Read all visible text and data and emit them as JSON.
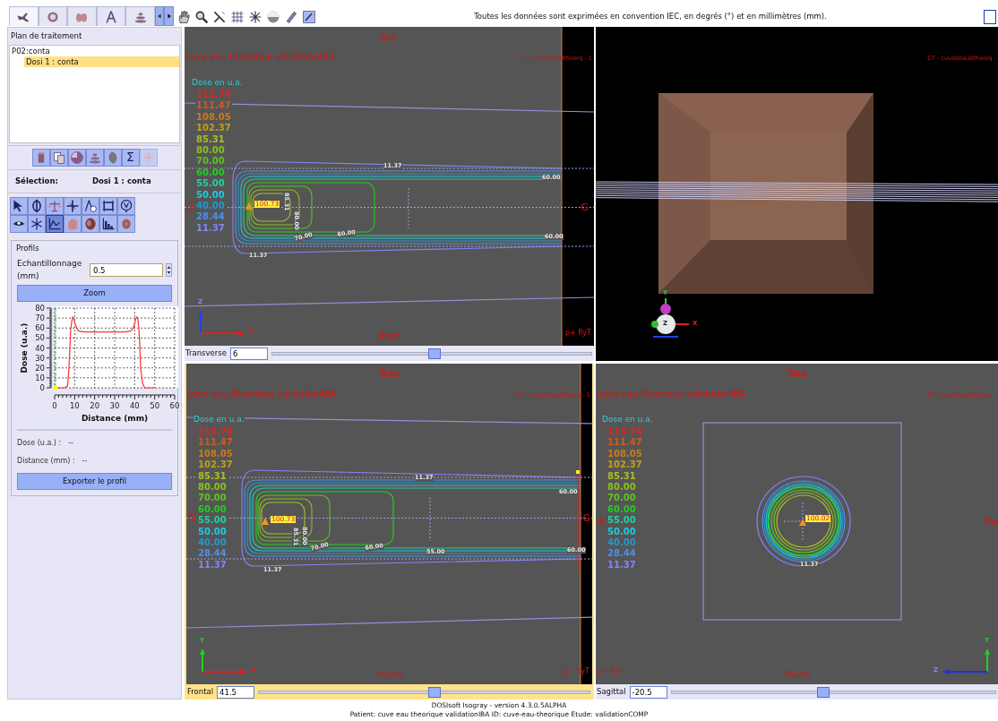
{
  "sidebar": {
    "tabs": [
      {
        "selected": true
      },
      {
        "selected": false
      },
      {
        "selected": false
      },
      {
        "selected": false
      },
      {
        "selected": false
      }
    ],
    "plan": {
      "title": "Plan de traitement",
      "items": [
        {
          "label": "P02:conta",
          "selected": false,
          "children": [
            {
              "label": "Dosi 1 : conta",
              "selected": true
            }
          ]
        }
      ]
    },
    "plan_toolbar": [
      {
        "disabled": false
      },
      {
        "disabled": false
      },
      {
        "disabled": false
      },
      {
        "disabled": false
      },
      {
        "disabled": false
      },
      {
        "label": "Σ",
        "disabled": false
      },
      {
        "disabled": true
      }
    ],
    "selection": {
      "label": "Sélection:",
      "value": "Dosi 1 : conta"
    },
    "tools": [
      {
        "selected": false
      },
      {
        "selected": false
      },
      {
        "selected": false
      },
      {
        "selected": false
      },
      {
        "selected": false
      },
      {
        "selected": false
      },
      {
        "selected": false
      },
      {
        "selected": false
      },
      {
        "selected": false
      },
      {
        "selected": true
      },
      {
        "selected": false
      },
      {
        "selected": false
      },
      {
        "selected": false
      },
      {
        "selected": false
      }
    ],
    "profils": {
      "title": "Profils",
      "sampling_label": "Echantillonnage (mm)",
      "sampling_value": "0.5",
      "zoom_button": "Zoom",
      "chart_data": {
        "type": "line",
        "grid": true,
        "xlabel": "Distance (mm)",
        "ylabel": "Dose (u.a.)",
        "xlim": [
          0,
          60
        ],
        "ylim": [
          0,
          80
        ],
        "xticks": [
          0,
          10,
          20,
          30,
          40,
          50,
          60
        ],
        "yticks": [
          0,
          10,
          20,
          30,
          40,
          50,
          60,
          70,
          80
        ],
        "x": [
          0,
          5,
          6.5,
          7,
          7.5,
          8,
          8.5,
          9,
          9.5,
          10,
          11,
          12,
          15,
          20,
          25,
          30,
          35,
          38,
          39,
          40,
          40.5,
          41,
          41.5,
          42,
          42.5,
          43,
          44,
          45,
          50
        ],
        "series": [
          {
            "color": "#ff3030",
            "values": [
              0,
              0,
              2,
              15,
              35,
              58,
              66,
              71,
              70,
              66,
              60,
              57,
              56,
              56,
              56,
              56,
              56,
              57,
              59,
              64,
              69,
              71,
              70,
              62,
              45,
              20,
              4,
              0,
              0
            ]
          }
        ]
      },
      "dose_label": "Dose (u.a.) :",
      "dose_value": "--",
      "distance_label": "Distance (mm) :",
      "distance_value": "--",
      "export_button": "Exporter le profil"
    }
  },
  "toolbar": {
    "message": "Toutes les données sont exprimées en convention IEC, en degrés (°) et en millimètres (mm)."
  },
  "views": [
    {
      "kind": "transverse",
      "selected": false,
      "top": "Ant",
      "bottom": "Post",
      "left": "D",
      "right": "G",
      "title": "cuve eau theorique validationIBA",
      "ct_label": "CT - cuve0eau0theorq - 1",
      "corner_label": "p+ RyT",
      "legend_title": "Dose en u.a.",
      "legend": [
        {
          "value": "113.74",
          "color": "#e82020"
        },
        {
          "value": "111.47",
          "color": "#d05a1e"
        },
        {
          "value": "108.05",
          "color": "#cc7a1c"
        },
        {
          "value": "102.37",
          "color": "#c0a01c"
        },
        {
          "value": "85.31",
          "color": "#a8c020"
        },
        {
          "value": "80.00",
          "color": "#88c020"
        },
        {
          "value": "70.00",
          "color": "#5cc41c"
        },
        {
          "value": "60.00",
          "color": "#20d020"
        },
        {
          "value": "55.00",
          "color": "#20d0a0"
        },
        {
          "value": "50.00",
          "color": "#20c8e0"
        },
        {
          "value": "40.00",
          "color": "#2098d0"
        },
        {
          "value": "28.44",
          "color": "#4a90f0"
        },
        {
          "value": "11.37",
          "color": "#8484ff"
        }
      ],
      "isodose_labels": [
        "11.37",
        "60.00",
        "85.31",
        "80.00",
        "70.00",
        "60.00",
        "60.00",
        "11.37"
      ],
      "max_dose": "100.73",
      "axes": {
        "vertical": "Z",
        "horizontal": "X"
      },
      "slider": {
        "label": "Transverse",
        "value": "6",
        "level": 0.51
      }
    },
    {
      "kind": "volume",
      "selected": false,
      "ct_label": "CT - cuve0eau0theorq -",
      "axes": {
        "vertical": "Y",
        "horizontal": "X",
        "depth": "Z"
      }
    },
    {
      "kind": "frontal",
      "selected": true,
      "top": "Tête",
      "bottom": "Pieds",
      "left": "D",
      "right": "G",
      "title": "cuve eau theorique validationIBA",
      "ct_label": "CT - cuve0eau0theorq - 1",
      "corner_label": "p+ RyT",
      "legend_title": "Dose en u.a.",
      "legend": [
        {
          "value": "113.74",
          "color": "#e82020"
        },
        {
          "value": "111.47",
          "color": "#d05a1e"
        },
        {
          "value": "108.05",
          "color": "#cc7a1c"
        },
        {
          "value": "102.37",
          "color": "#c0a01c"
        },
        {
          "value": "85.31",
          "color": "#a8c020"
        },
        {
          "value": "80.00",
          "color": "#88c020"
        },
        {
          "value": "70.00",
          "color": "#5cc41c"
        },
        {
          "value": "60.00",
          "color": "#20d020"
        },
        {
          "value": "55.00",
          "color": "#20d0a0"
        },
        {
          "value": "50.00",
          "color": "#20c8e0"
        },
        {
          "value": "40.00",
          "color": "#2098d0"
        },
        {
          "value": "28.44",
          "color": "#4a90f0"
        },
        {
          "value": "11.37",
          "color": "#8484ff"
        }
      ],
      "isodose_labels": [
        "11.37",
        "60.00",
        "85.31",
        "80.00",
        "70.00",
        "60.00",
        "55.00",
        "60.00",
        "11.37"
      ],
      "max_dose": "100.73",
      "axes": {
        "vertical": "Y",
        "horizontal": "X"
      },
      "slider": {
        "label": "Frontal",
        "value": "41.5",
        "level": 0.53
      }
    },
    {
      "kind": "sagittal",
      "selected": false,
      "top": "Tête",
      "bottom": "Pieds",
      "left": "A",
      "right": "Po",
      "title": "cuve eau theorique validationIBA",
      "ct_label": "CT - cuve0eau0theorq -",
      "corner_label": "p+ RyT",
      "legend_title": "Dose en u.a.",
      "legend": [
        {
          "value": "113.74",
          "color": "#e82020"
        },
        {
          "value": "111.47",
          "color": "#d05a1e"
        },
        {
          "value": "108.05",
          "color": "#cc7a1c"
        },
        {
          "value": "102.37",
          "color": "#c0a01c"
        },
        {
          "value": "85.31",
          "color": "#a8c020"
        },
        {
          "value": "80.00",
          "color": "#88c020"
        },
        {
          "value": "70.00",
          "color": "#5cc41c"
        },
        {
          "value": "60.00",
          "color": "#20d020"
        },
        {
          "value": "55.00",
          "color": "#20d0a0"
        },
        {
          "value": "50.00",
          "color": "#20c8e0"
        },
        {
          "value": "40.00",
          "color": "#2098d0"
        },
        {
          "value": "28.44",
          "color": "#4a90f0"
        },
        {
          "value": "11.37",
          "color": "#8484ff"
        }
      ],
      "isodose_labels": [
        "11.37"
      ],
      "max_dose": "100.02",
      "axes": {
        "vertical": "Y",
        "horizontal": "Z"
      },
      "slider": {
        "label": "Sagittal",
        "value": "-20.5",
        "level": 0.47
      }
    }
  ],
  "footer": [
    "DOSIsoft Isogray - version 4.3.0.5ALPHA",
    "Patient: cuve eau theorique validationIBA ID: cuve-eau-theorique Etude: validationCOMP"
  ]
}
